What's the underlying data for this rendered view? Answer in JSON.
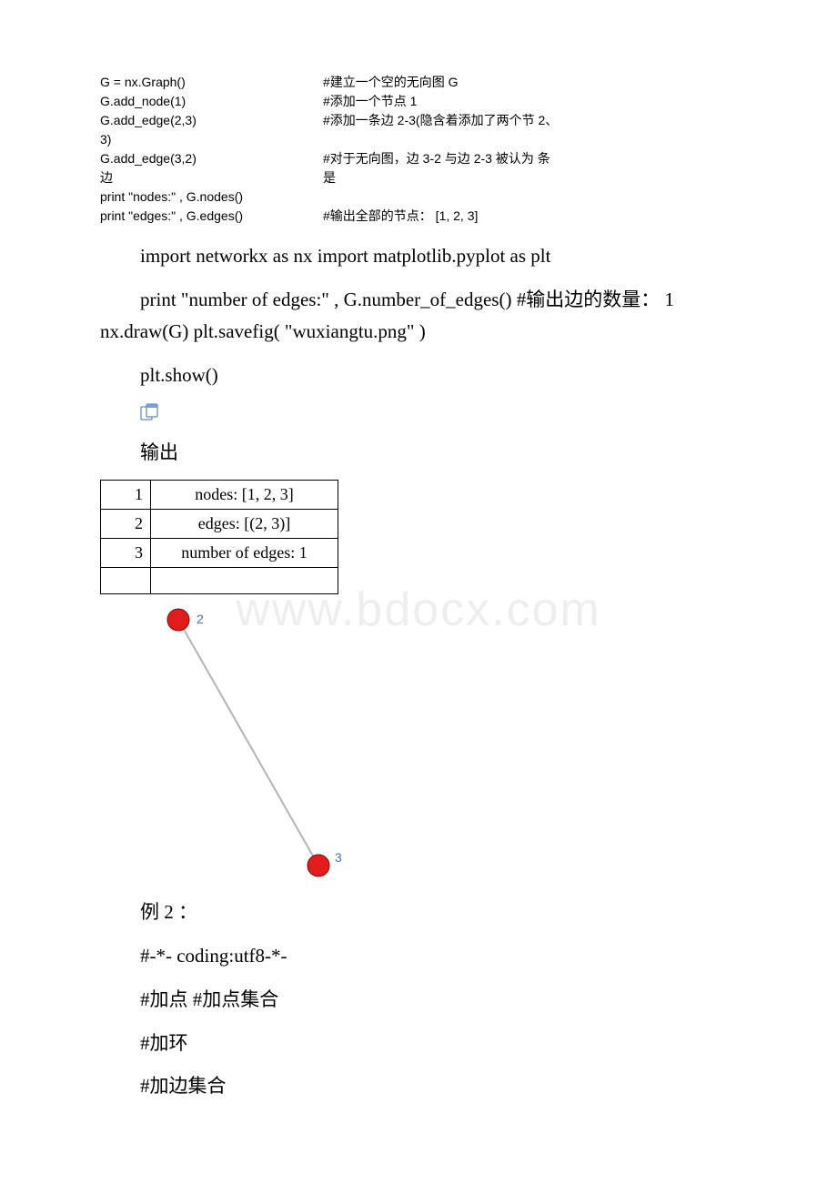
{
  "code_block": {
    "rows": [
      {
        "left": "G = nx.Graph()",
        "right": "#建立一个空的无向图  G"
      },
      {
        "left": "G.add_node(1)",
        "right": "#添加一个节点  1"
      },
      {
        "left": "G.add_edge(2,3)",
        "right": "#添加一条边  2-3(隐含着添加了两个节      2、"
      },
      {
        "left": "3)",
        "right": ""
      },
      {
        "left": "G.add_edge(3,2)",
        "right": "#对于无向图，边  3-2  与边  2-3  被认为    条"
      },
      {
        "left": "边",
        "right": "是"
      },
      {
        "left": "print \"nodes:\" , G.nodes()",
        "right": ""
      },
      {
        "left": "print \"edges:\" , G.edges()",
        "right": "#输出全部的节点：  [1, 2, 3]"
      }
    ]
  },
  "para1": "import networkx as nx import matplotlib.pyplot as plt",
  "para2": "print \"number of edges:\" , G.number_of_edges() #输出边的数量：  1 nx.draw(G) plt.savefig( \"wuxiangtu.png\" )",
  "para3": "plt.show()",
  "output_label": "输出",
  "output_table": {
    "rows": [
      {
        "idx": "1",
        "val": "nodes: [1, 2, 3]"
      },
      {
        "idx": "2",
        "val": "edges: [(2, 3)]"
      },
      {
        "idx": "3",
        "val": "number of edges: 1"
      }
    ]
  },
  "watermark": "www.bdocx.com",
  "graph": {
    "node2_label": "2",
    "node3_label": "3",
    "node_color": "#e21b1b",
    "edge_color": "#b4b4b4",
    "label_color": "#4b6fc8"
  },
  "example_label": "例 2 ：",
  "code_lines": [
    "#-*- coding:utf8-*-",
    "#加点 #加点集合",
    "#加环",
    "#加边集合"
  ],
  "chart_data": {
    "type": "network-graph",
    "nodes": [
      {
        "id": 2,
        "x": 0.18,
        "y": 0.05
      },
      {
        "id": 3,
        "x": 0.78,
        "y": 0.95
      }
    ],
    "edges": [
      {
        "from": 2,
        "to": 3
      }
    ],
    "directed": false
  }
}
